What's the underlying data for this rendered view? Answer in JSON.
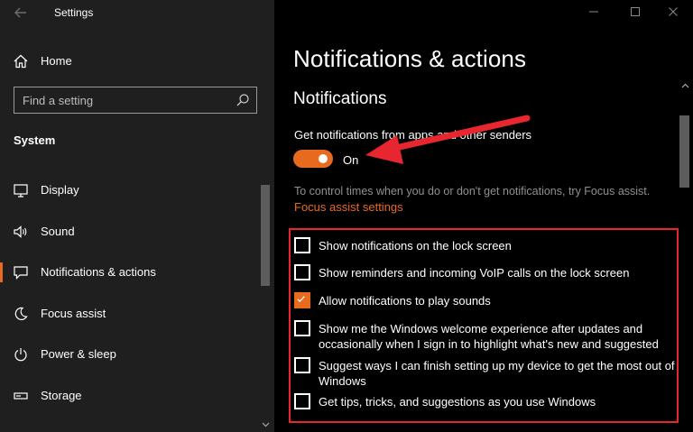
{
  "window": {
    "title": "Settings"
  },
  "sidebar": {
    "home_label": "Home",
    "search_placeholder": "Find a setting",
    "section_title": "System",
    "items": [
      {
        "label": "Display",
        "icon": "monitor-icon"
      },
      {
        "label": "Sound",
        "icon": "speaker-icon"
      },
      {
        "label": "Notifications & actions",
        "icon": "notification-icon",
        "selected": true
      },
      {
        "label": "Focus assist",
        "icon": "moon-icon"
      },
      {
        "label": "Power & sleep",
        "icon": "power-icon"
      },
      {
        "label": "Storage",
        "icon": "storage-icon"
      }
    ]
  },
  "main": {
    "page_title": "Notifications & actions",
    "section_title": "Notifications",
    "get_notifications_label": "Get notifications from apps and other senders",
    "toggle": {
      "state_label": "On",
      "on": true
    },
    "focus_hint": "To control times when you do or don't get notifications, try Focus assist.",
    "focus_link": "Focus assist settings",
    "checkboxes": [
      {
        "label": "Show notifications on the lock screen",
        "checked": false
      },
      {
        "label": "Show reminders and incoming VoIP calls on the lock screen",
        "checked": false
      },
      {
        "label": "Allow notifications to play sounds",
        "checked": true
      },
      {
        "label": "Show me the Windows welcome experience after updates and occasionally when I sign in to highlight what's new and suggested",
        "checked": false
      },
      {
        "label": "Suggest ways I can finish setting up my device to get the most out of Windows",
        "checked": false
      },
      {
        "label": "Get tips, tricks, and suggestions as you use Windows",
        "checked": false
      }
    ]
  },
  "colors": {
    "accent": "#e76a1e",
    "annotation": "#e8262f",
    "sidebar_bg": "#1f1f1f",
    "main_bg": "#000000"
  }
}
